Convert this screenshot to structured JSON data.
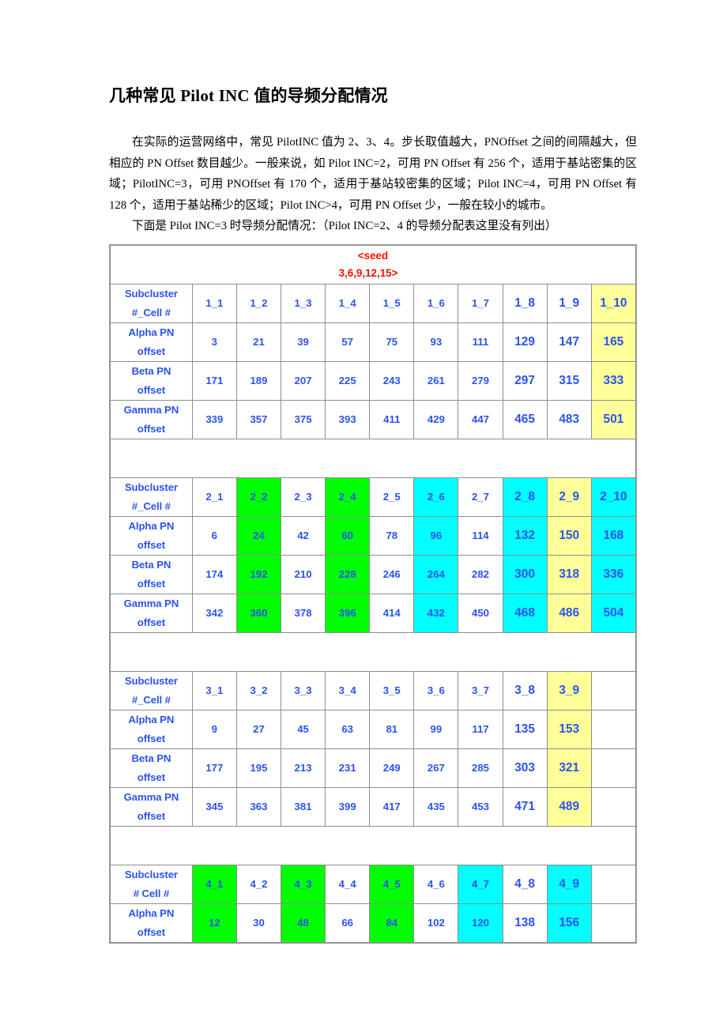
{
  "document": {
    "title": "几种常见 Pilot INC 值的导频分配情况",
    "paragraphs": [
      "在实际的运营网络中，常见 PilotINC 值为 2、3、4。步长取值越大，PNOffset 之间的间隔越大，但相应的 PN Offset 数目越少。一般来说，如 Pilot INC=2，可用 PN Offset 有 256 个，适用于基站密集的区域；PilotINC=3，可用 PNOffset 有 170 个，适用于基站较密集的区域；Pilot INC=4，可用 PN Offset 有 128 个，适用于基站稀少的区域；Pilot INC>4，可用 PN Offset 少，一般在较小的城市。",
      "下面是 Pilot INC=3 时导频分配情况：（Pilot INC=2、4 的导频分配表这里没有列出）"
    ]
  },
  "colors": {
    "text_blue": "#2c53ee",
    "seed_red": "#ee1100",
    "highlight_green": "#00ff00",
    "highlight_cyan": "#00ffff",
    "highlight_yellow": "#ffff99",
    "border_gray": "#8e8e8e"
  },
  "table": {
    "seed_label_line1": "<seed",
    "seed_label_line2": "3,6,9,12,15>",
    "row_labels": {
      "subcluster": "Subcluster",
      "subcluster_2": "#_Cell #",
      "subcluster_2_alt": "#  Cell #",
      "alpha": "Alpha PN",
      "alpha_2": "offset",
      "beta": "Beta PN",
      "beta_2": "offset",
      "gamma": "Gamma PN",
      "gamma_2": "offset"
    },
    "blocks": [
      {
        "id": "block-1",
        "columns": 10,
        "cell_ids": [
          "1_1",
          "1_2",
          "1_3",
          "1_4",
          "1_5",
          "1_6",
          "1_7",
          "1_8",
          "1_9",
          "1_10"
        ],
        "cell_id_sizes": [
          "sm",
          "sm",
          "sm",
          "sm",
          "sm",
          "sm",
          "sm",
          "big",
          "big",
          "big"
        ],
        "alpha": [
          "3",
          "21",
          "39",
          "57",
          "75",
          "93",
          "111",
          "129",
          "147",
          "165"
        ],
        "alpha_sizes": [
          "sm",
          "sm",
          "sm",
          "sm",
          "sm",
          "sm",
          "sm",
          "big",
          "big",
          "big"
        ],
        "beta": [
          "171",
          "189",
          "207",
          "225",
          "243",
          "261",
          "279",
          "297",
          "315",
          "333"
        ],
        "beta_sizes": [
          "sm",
          "sm",
          "sm",
          "sm",
          "sm",
          "sm",
          "sm",
          "big",
          "big",
          "big"
        ],
        "gamma": [
          "339",
          "357",
          "375",
          "393",
          "411",
          "429",
          "447",
          "465",
          "483",
          "501"
        ],
        "gamma_sizes": [
          "sm",
          "sm",
          "sm",
          "sm",
          "sm",
          "sm",
          "sm",
          "big",
          "big",
          "big"
        ],
        "highlights": [
          "",
          "",
          "",
          "",
          "",
          "",
          "",
          "",
          "",
          "yellow"
        ],
        "label_variant": "underscore"
      },
      {
        "id": "block-2",
        "columns": 10,
        "cell_ids": [
          "2_1",
          "2_2",
          "2_3",
          "2_4",
          "2_5",
          "2_6",
          "2_7",
          "2_8",
          "2_9",
          "2_10"
        ],
        "cell_id_sizes": [
          "sm",
          "sm",
          "sm",
          "sm",
          "sm",
          "sm",
          "sm",
          "big",
          "big",
          "big"
        ],
        "alpha": [
          "6",
          "24",
          "42",
          "60",
          "78",
          "96",
          "114",
          "132",
          "150",
          "168"
        ],
        "alpha_sizes": [
          "sm",
          "sm",
          "sm",
          "sm",
          "sm",
          "sm",
          "sm",
          "big",
          "big",
          "big"
        ],
        "beta": [
          "174",
          "192",
          "210",
          "228",
          "246",
          "264",
          "282",
          "300",
          "318",
          "336"
        ],
        "beta_sizes": [
          "sm",
          "sm",
          "sm",
          "sm",
          "sm",
          "sm",
          "sm",
          "big",
          "big",
          "big"
        ],
        "gamma": [
          "342",
          "360",
          "378",
          "396",
          "414",
          "432",
          "450",
          "468",
          "486",
          "504"
        ],
        "gamma_sizes": [
          "sm",
          "sm",
          "sm",
          "sm",
          "sm",
          "sm",
          "sm",
          "big",
          "big",
          "big"
        ],
        "highlights": [
          "",
          "green",
          "",
          "green",
          "",
          "cyan",
          "",
          "cyan",
          "yellow",
          "cyan"
        ],
        "label_variant": "underscore"
      },
      {
        "id": "block-3",
        "columns": 9,
        "cell_ids": [
          "3_1",
          "3_2",
          "3_3",
          "3_4",
          "3_5",
          "3_6",
          "3_7",
          "3_8",
          "3_9"
        ],
        "cell_id_sizes": [
          "sm",
          "sm",
          "sm",
          "sm",
          "sm",
          "sm",
          "sm",
          "big",
          "big"
        ],
        "alpha": [
          "9",
          "27",
          "45",
          "63",
          "81",
          "99",
          "117",
          "135",
          "153"
        ],
        "alpha_sizes": [
          "sm",
          "sm",
          "sm",
          "sm",
          "sm",
          "sm",
          "sm",
          "big",
          "big"
        ],
        "beta": [
          "177",
          "195",
          "213",
          "231",
          "249",
          "267",
          "285",
          "303",
          "321"
        ],
        "beta_sizes": [
          "sm",
          "sm",
          "sm",
          "sm",
          "sm",
          "sm",
          "sm",
          "big",
          "big"
        ],
        "gamma": [
          "345",
          "363",
          "381",
          "399",
          "417",
          "435",
          "453",
          "471",
          "489"
        ],
        "gamma_sizes": [
          "sm",
          "sm",
          "sm",
          "sm",
          "sm",
          "sm",
          "sm",
          "big",
          "big"
        ],
        "highlights": [
          "",
          "",
          "",
          "",
          "",
          "",
          "",
          "",
          "yellow"
        ],
        "label_variant": "underscore"
      },
      {
        "id": "block-4",
        "columns": 9,
        "cell_ids": [
          "4_1",
          "4_2",
          "4_3",
          "4_4",
          "4_5",
          "4_6",
          "4_7",
          "4_8",
          "4_9"
        ],
        "cell_id_sizes": [
          "sm",
          "sm",
          "sm",
          "sm",
          "sm",
          "sm",
          "sm",
          "big",
          "big"
        ],
        "alpha": [
          "12",
          "30",
          "48",
          "66",
          "84",
          "102",
          "120",
          "138",
          "156"
        ],
        "alpha_sizes": [
          "sm",
          "sm",
          "sm",
          "sm",
          "sm",
          "sm",
          "sm",
          "big",
          "big"
        ],
        "beta": [],
        "gamma": [],
        "highlights": [
          "green",
          "",
          "green",
          "",
          "green",
          "",
          "cyan",
          "",
          "cyan"
        ],
        "label_variant": "space"
      }
    ]
  }
}
